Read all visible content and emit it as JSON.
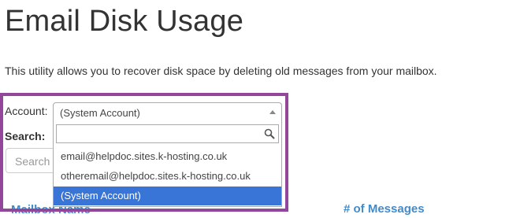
{
  "page": {
    "title": "Email Disk Usage",
    "description": "This utility allows you to recover disk space by deleting old messages from your mailbox."
  },
  "form": {
    "account_label": "Account:",
    "search_label": "Search:",
    "search_placeholder": "Search"
  },
  "account_select": {
    "selected": "(System Account)",
    "options": [
      "email@helpdoc.sites.k-hosting.co.uk",
      "otheremail@helpdoc.sites.k-hosting.co.uk",
      "(System Account)"
    ],
    "highlighted_option": "(System Account)"
  },
  "table": {
    "columns": [
      "Mailbox Name",
      "# of Messages"
    ]
  },
  "colors": {
    "highlight_border": "#93479a",
    "option_selected_bg": "#3875d7",
    "link_blue": "#428bca"
  }
}
